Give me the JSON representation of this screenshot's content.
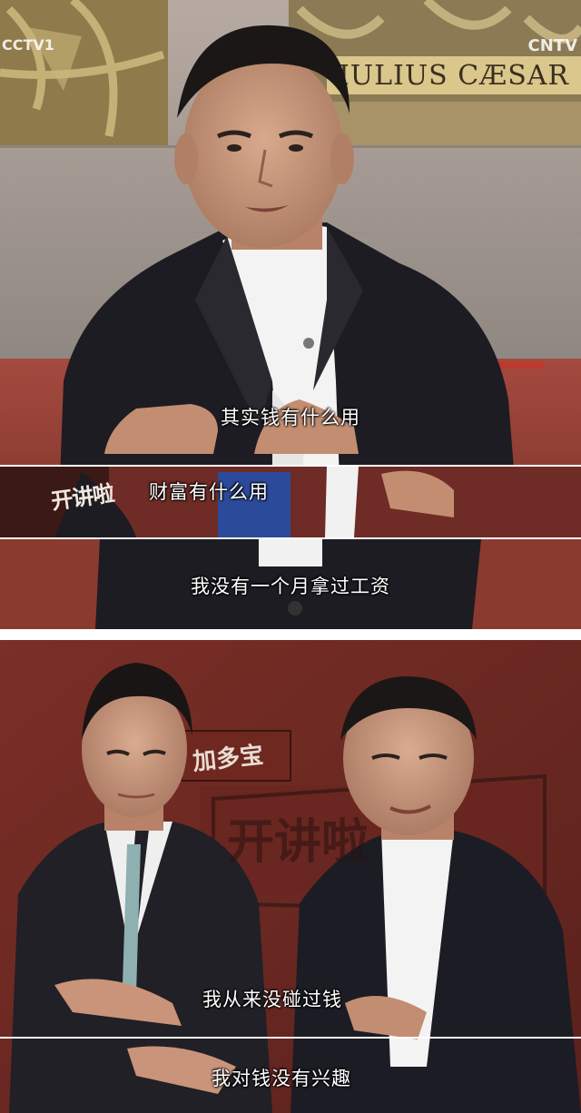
{
  "panel_top": {
    "channel_logo": "CCTV1",
    "watermark": "CNTV",
    "window_inscription": "IULIUS CÆSAR",
    "subtitles": [
      "其实钱有什么用",
      "财富有什么用",
      "我没有一个月拿过工资"
    ],
    "show_logo": "开讲啦"
  },
  "panel_bottom": {
    "show_logo": "开讲啦",
    "sponsor_text": "加多宝",
    "subtitles": [
      "我从来没碰过钱",
      "我对钱没有兴趣"
    ]
  },
  "colors": {
    "stage_red": "#8a3a2f",
    "suit_dark": "#1c1c24",
    "stone_gray": "#a59c96",
    "subtitle": "#ffffff"
  }
}
